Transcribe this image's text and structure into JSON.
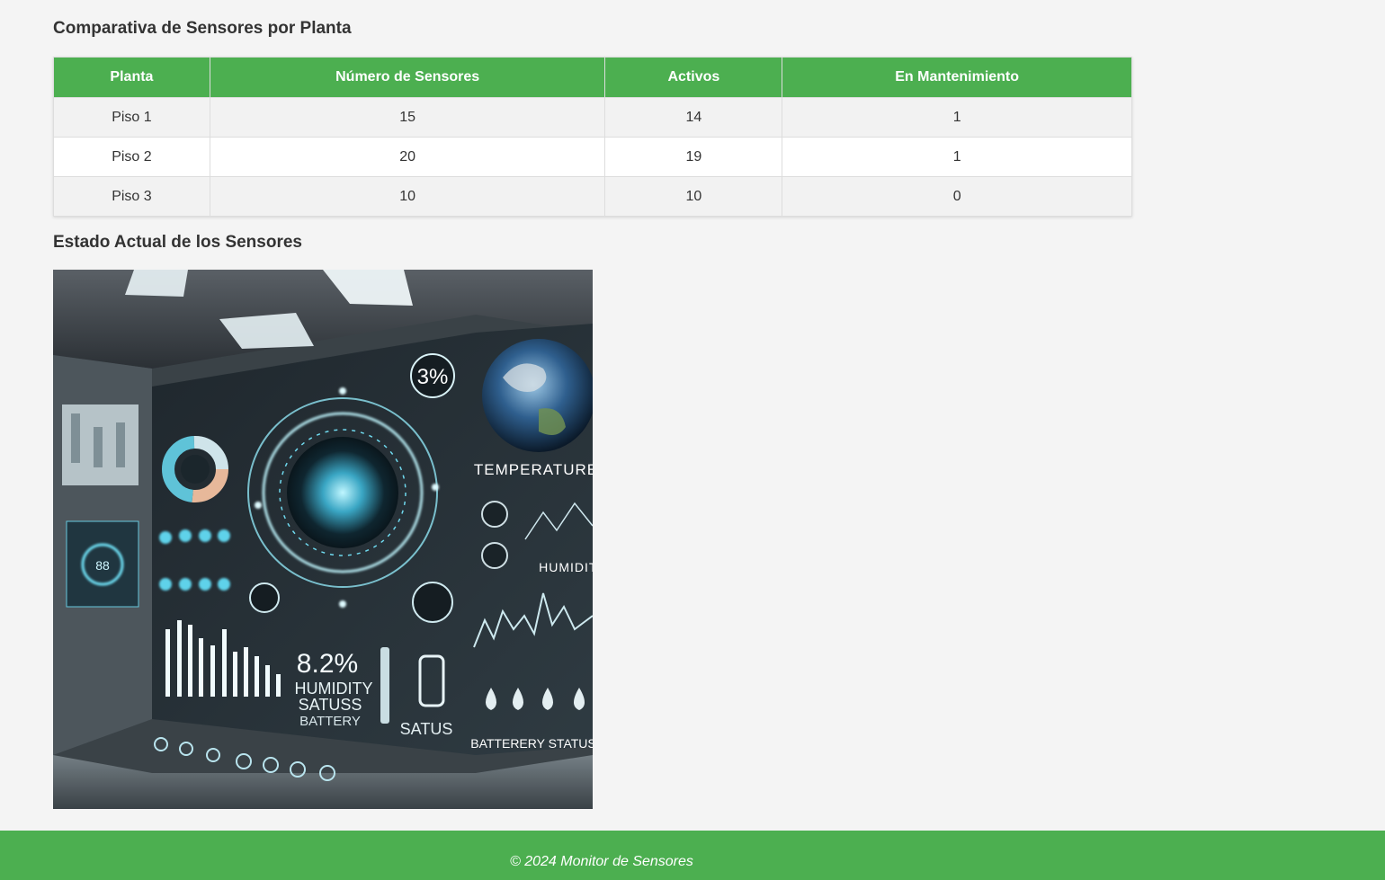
{
  "sections": {
    "comparison_title": "Comparativa de Sensores por Planta",
    "status_title": "Estado Actual de los Sensores"
  },
  "table": {
    "headers": [
      "Planta",
      "Número de Sensores",
      "Activos",
      "En Mantenimiento"
    ],
    "rows": [
      [
        "Piso 1",
        "15",
        "14",
        "1"
      ],
      [
        "Piso 2",
        "20",
        "19",
        "1"
      ],
      [
        "Piso 3",
        "10",
        "10",
        "0"
      ]
    ]
  },
  "image": {
    "overlay_text": {
      "percent_top": "3%",
      "temperature": "TEMPERATURE",
      "humidity": "HUMIDITY",
      "percent_bottom": "8.2%",
      "humidity_2": "HUMIDITY",
      "satuss": "SATUSS",
      "battery": "BATTERY",
      "satus": "SATUS",
      "battery_status": "BATTERERY STATUS",
      "small_readout": "88"
    }
  },
  "footer": {
    "text": "© 2024 Monitor de Sensores"
  },
  "colors": {
    "accent": "#4caf50",
    "background": "#f4f4f4",
    "row_stripe": "#f2f2f2",
    "text": "#333333"
  }
}
